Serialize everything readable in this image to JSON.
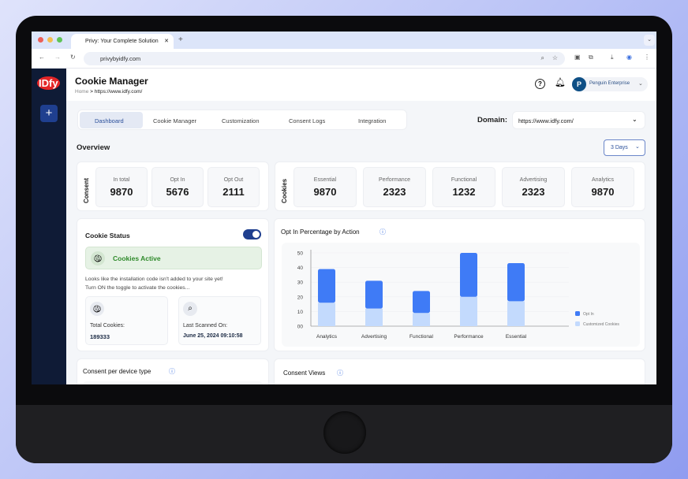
{
  "browser": {
    "tab_title": "Privy: Your Complete Solution",
    "url": "privybyidfy.com"
  },
  "brand": {
    "logo": "IDfy"
  },
  "header": {
    "title": "Cookie Manager",
    "breadcrumb_home": "Home",
    "breadcrumb_sep": ">",
    "breadcrumb_current": "https://www.idfy.com/",
    "account_initial": "P",
    "account_name": "Penguin Enterprise"
  },
  "tabs": [
    {
      "label": "Dashboard",
      "active": true
    },
    {
      "label": "Cookie Manager"
    },
    {
      "label": "Customization"
    },
    {
      "label": "Consent Logs"
    },
    {
      "label": "Integration"
    }
  ],
  "domain": {
    "label": "Domain:",
    "value": "https://www.idfy.com/"
  },
  "overview": {
    "title": "Overview",
    "range": "3 Days"
  },
  "consent": {
    "label": "Consent",
    "stats": [
      {
        "label": "In total",
        "value": "9870"
      },
      {
        "label": "Opt In",
        "value": "5676"
      },
      {
        "label": "Opt Out",
        "value": "2111"
      }
    ]
  },
  "cookies": {
    "label": "Cookies",
    "stats": [
      {
        "label": "Essential",
        "value": "9870"
      },
      {
        "label": "Performance",
        "value": "2323"
      },
      {
        "label": "Functional",
        "value": "1232"
      },
      {
        "label": "Advertising",
        "value": "2323"
      },
      {
        "label": "Analytics",
        "value": "9870"
      }
    ]
  },
  "cookie_status": {
    "title": "Cookie Status",
    "toggle_on": true,
    "banner": "Cookies Active",
    "message_line1": "Looks like the installation code isn't added to your site yet!",
    "message_line2": "Turn ON the toggle to activate the cookies...",
    "total_label": "Total Cookies:",
    "total_value": "189333",
    "scanned_label": "Last Scanned On:",
    "scanned_value": "June 25, 2024 09:10:58"
  },
  "bottom": {
    "device_title": "Consent per device type",
    "views_title": "Consent Views"
  },
  "colors": {
    "opt_in": "#3f7bf6",
    "customized": "#c3dafd",
    "sidebar": "#0f1b36",
    "accent": "#1f3f8f"
  },
  "chart_data": {
    "type": "bar",
    "stacked": true,
    "title": "Opt In Percentage by Action",
    "categories": [
      "Analytics",
      "Advertising",
      "Functional",
      "Performance",
      "Essential"
    ],
    "series": [
      {
        "name": "Customized Cookies",
        "values": [
          16,
          12,
          9,
          20,
          17
        ]
      },
      {
        "name": "Opt In",
        "values": [
          23,
          19,
          15,
          30,
          26
        ]
      }
    ],
    "yticks": [
      "00",
      "10",
      "20",
      "30",
      "40",
      "50"
    ],
    "ylim": [
      0,
      50
    ],
    "legend": "right"
  }
}
